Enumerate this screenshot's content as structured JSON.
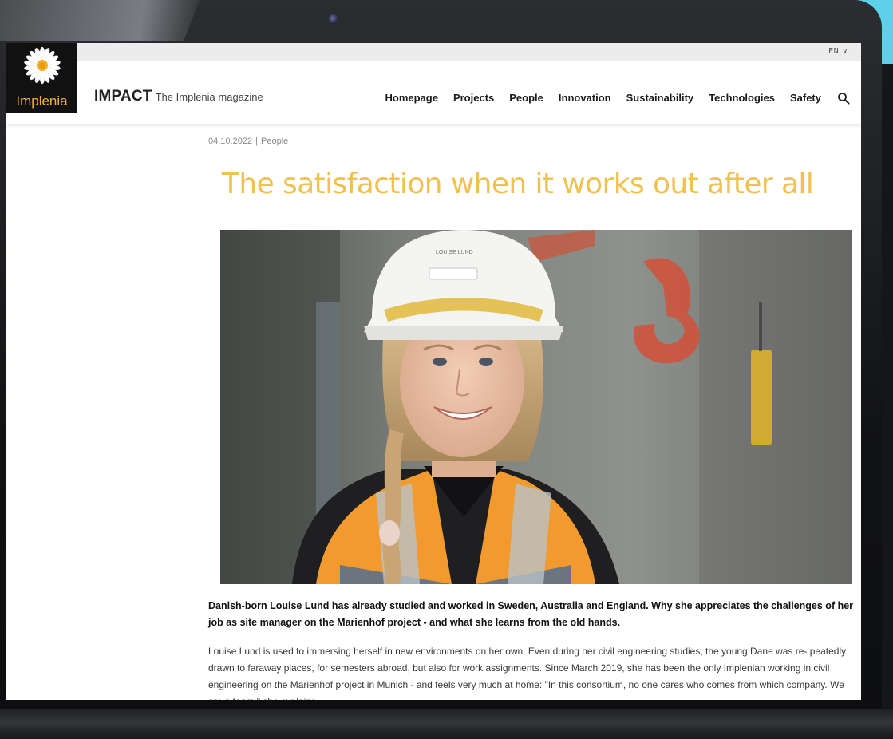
{
  "language": {
    "label": "EN"
  },
  "logo": {
    "text": "Implenia"
  },
  "brand": {
    "name": "IMPACT",
    "tagline": "The Implenia magazine"
  },
  "nav": {
    "items": [
      "Homepage",
      "Projects",
      "People",
      "Innovation",
      "Sustainability",
      "Technologies",
      "Safety"
    ]
  },
  "article": {
    "date": "04.10.2022",
    "category": "People",
    "title": "The satisfaction when it works out after all",
    "helmet_text": "LOUISE LUND",
    "lead": "Danish-born Louise Lund has already studied and worked in Sweden, Australia and England. Why she appreciates the challenges of her job as site manager on the Marienhof project - and what she learns from the old hands.",
    "body": "Louise Lund is used to immersing herself in new environments on her own. Even during her civil engineering studies, the young Dane was re- peatedly drawn to faraway places, for semesters abroad, but also for work assignments. Since March 2019, she has been the only Implenian working in civil engineering on the Marienhof project in Munich - and feels very much at home: \"In this consortium, no one cares who comes from which company. We are a team,\" she explains."
  },
  "colors": {
    "title": "#f0c150",
    "logo_text": "#f2b32d",
    "accent_cyan": "#5fd0ea"
  }
}
